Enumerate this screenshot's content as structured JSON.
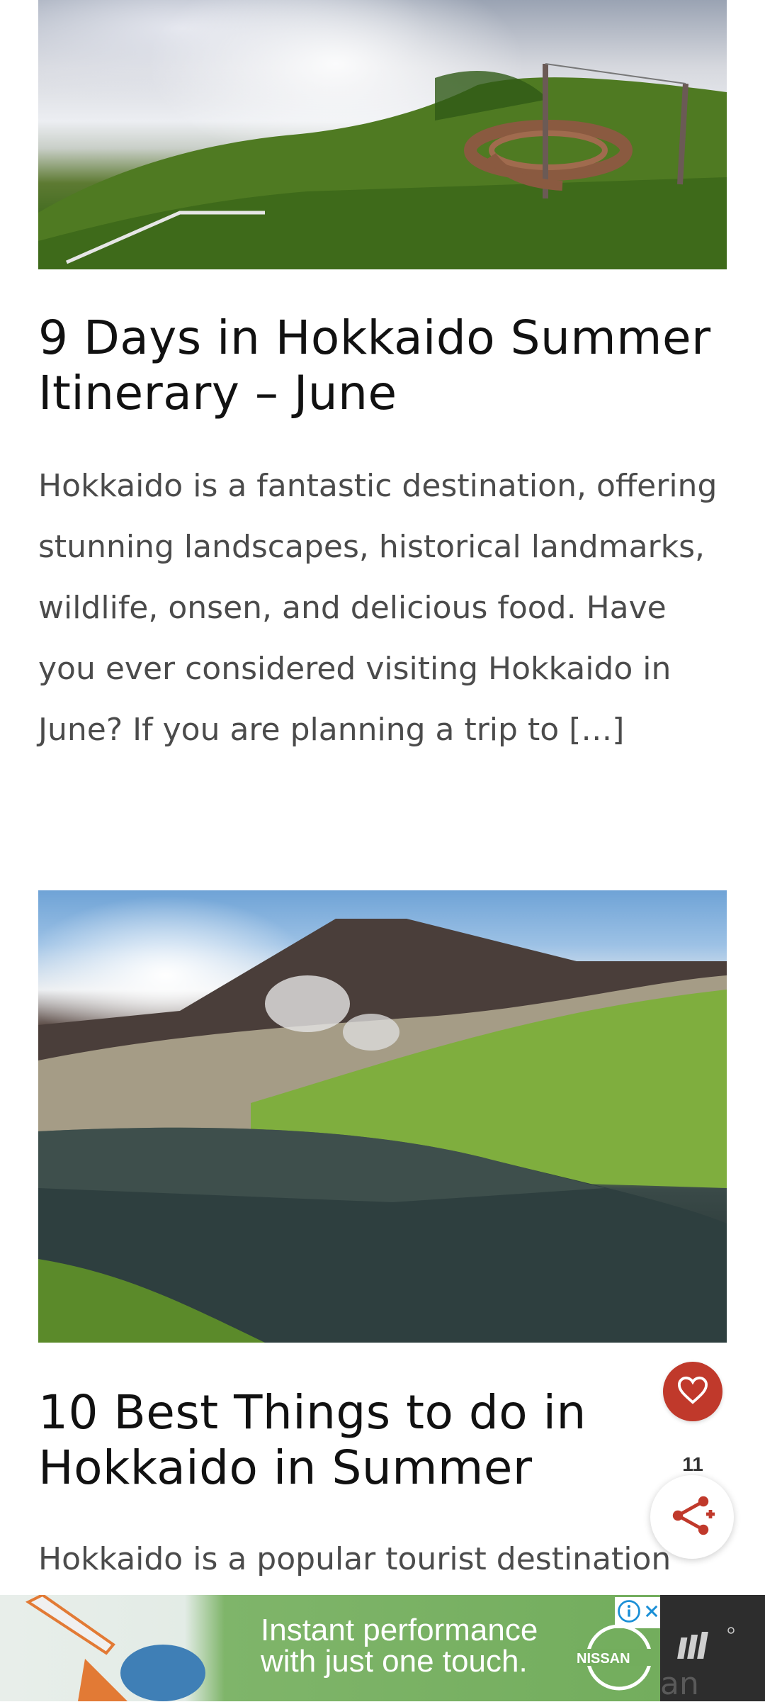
{
  "posts": [
    {
      "title": "9 Days in Hokkaido Summer Itinerary – June",
      "excerpt": "Hokkaido is a fantastic destination, offering stunning landscapes, historical landmarks, wildlife, onsen, and delicious food. Have you ever considered visiting Hokkaido in June? If you are planning a trip to […]"
    },
    {
      "title": "10 Best Things to do in Hokkaido in Summer",
      "excerpt": "Hokkaido is a popular tourist destination during"
    }
  ],
  "floating": {
    "share_count": "11",
    "like_icon": "heart-icon",
    "share_icon": "share-icon",
    "accent_color": "#c0392b"
  },
  "ad": {
    "line1": "Instant performance",
    "line2": "with just one touch.",
    "brand": "NISSAN",
    "side_text": "an"
  }
}
